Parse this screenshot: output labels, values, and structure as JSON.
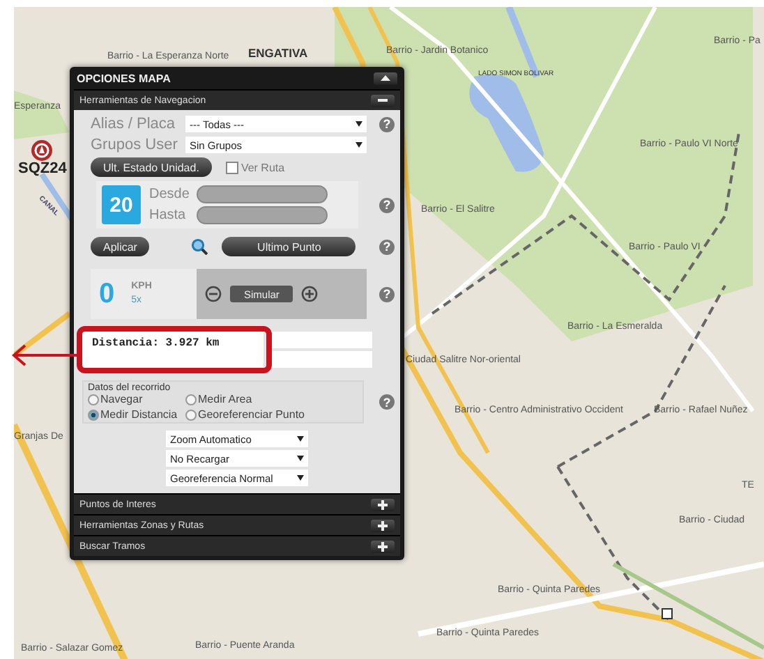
{
  "map": {
    "labels": [
      {
        "text": "Barrio - La Esperanza Norte"
      },
      {
        "text": "ENGATIVA"
      },
      {
        "text": "Barrio - Jardin Botanico"
      },
      {
        "text": "LADO SIMON BOLIVAR"
      },
      {
        "text": "Barrio - Pa"
      },
      {
        "text": "Esperanza"
      },
      {
        "text": "Barrio - Paulo VI Norte"
      },
      {
        "text": "Barrio - El Salitre"
      },
      {
        "text": "Barrio - Paulo VI"
      },
      {
        "text": "Barrio - La Esmeralda"
      },
      {
        "text": "Ciudad Salitre Nor-oriental"
      },
      {
        "text": "Barrio - Centro Administrativo Occident"
      },
      {
        "text": "Barrio - Rafael Nuñez"
      },
      {
        "text": "Granjas De"
      },
      {
        "text": "TE"
      },
      {
        "text": "Barrio - Ciudad"
      },
      {
        "text": "Barrio - Quinta Paredes"
      },
      {
        "text": "Barrio - Quinta Paredes"
      },
      {
        "text": "Barrio - Salazar Gomez"
      },
      {
        "text": "Barrio - Puente Aranda"
      },
      {
        "text": "CANAL"
      }
    ],
    "marker": {
      "label": "SQZ24"
    }
  },
  "panel": {
    "title": "OPCIONES MAPA",
    "navigation": {
      "title": "Herramientas de Navegacion",
      "expanded": true,
      "alias": {
        "label": "Alias / Placa",
        "value": "--- Todas ---",
        "help": "?"
      },
      "grupos": {
        "label": "Grupos User",
        "value": "Sin Grupos"
      },
      "status_button": "Ult. Estado Unidad.",
      "ver_ruta": {
        "label": "Ver Ruta",
        "checked": false
      },
      "calendar_day": "20",
      "desde": {
        "label": "Desde"
      },
      "hasta": {
        "label": "Hasta"
      },
      "dates_help": "?",
      "apply_button": "Aplicar",
      "last_point_button": "Ultimo Punto",
      "apply_help": "?",
      "speed": {
        "value": "0",
        "unit": "KPH",
        "factor": "5x",
        "simulate_button": "Simular",
        "help": "?"
      },
      "distance": "Distancia: 3.927 km",
      "route": {
        "title": "Datos del recorrido",
        "help": "?",
        "options": [
          {
            "label": "Navegar",
            "selected": false
          },
          {
            "label": "Medir Area",
            "selected": false
          },
          {
            "label": "Medir Distancia",
            "selected": true
          },
          {
            "label": "Georeferenciar Punto",
            "selected": false
          }
        ]
      },
      "selects": [
        {
          "value": "Zoom Automatico"
        },
        {
          "value": "No Recargar"
        },
        {
          "value": "Georeferencia Normal"
        }
      ]
    },
    "sections": [
      {
        "title": "Puntos de Interes",
        "expanded": false
      },
      {
        "title": "Herramientas Zonas y Rutas",
        "expanded": false
      },
      {
        "title": "Buscar Tramos",
        "expanded": false
      }
    ]
  }
}
